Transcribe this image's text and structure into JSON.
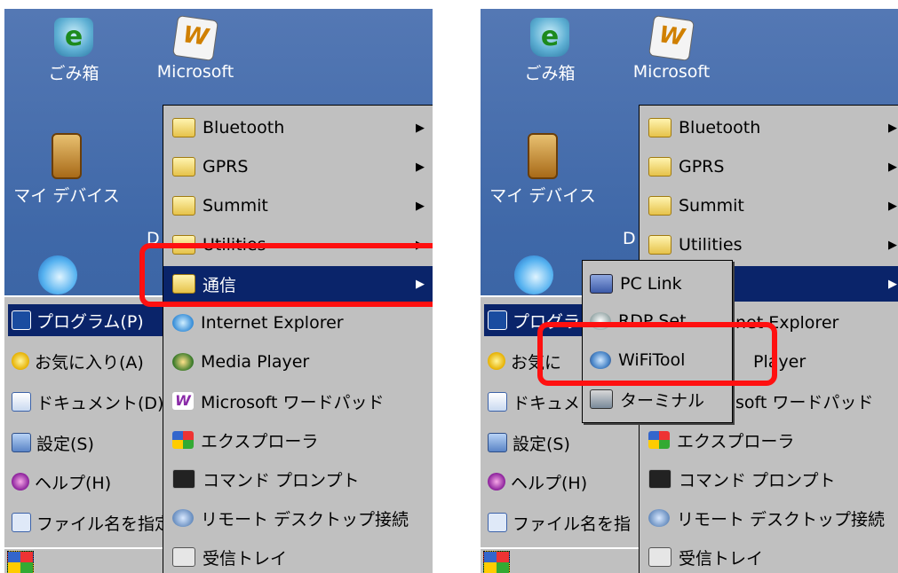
{
  "desktop": {
    "recycle_label": "ごみ箱",
    "wordpad_label": "Microsoft",
    "device_label": "マイ デバイス"
  },
  "start_menu": {
    "programs": "プログラム(P)",
    "favorites": "お気に入り(A)",
    "documents": "ドキュメント(D)",
    "settings": "設定(S)",
    "help": "ヘルプ(H)",
    "run": "ファイル名を指定して実行"
  },
  "programs_menu": {
    "items": [
      {
        "label": "Bluetooth",
        "icon": "folder-icon",
        "submenu": true
      },
      {
        "label": "GPRS",
        "icon": "folder-icon",
        "submenu": true
      },
      {
        "label": "Summit",
        "icon": "folder-icon",
        "submenu": true
      },
      {
        "label": "Utilities",
        "icon": "folder-icon",
        "submenu": true
      },
      {
        "label": "通信",
        "icon": "folder-icon",
        "submenu": true
      },
      {
        "label": "Internet Explorer",
        "icon": "internet-explorer-icon"
      },
      {
        "label": "Media Player",
        "icon": "media-player-icon"
      },
      {
        "label": "Microsoft ワードパッド",
        "icon": "wordpad-icon"
      },
      {
        "label": "エクスプローラ",
        "icon": "explorer-icon"
      },
      {
        "label": "コマンド プロンプト",
        "icon": "command-prompt-icon"
      },
      {
        "label": "リモート デスクトップ接続",
        "icon": "remote-desktop-icon"
      },
      {
        "label": "受信トレイ",
        "icon": "inbox-icon"
      }
    ]
  },
  "communication_submenu": {
    "items": [
      {
        "label": "PC Link",
        "icon": "pc-link-icon"
      },
      {
        "label": "RDP Set",
        "icon": "rdp-set-icon"
      },
      {
        "label": "WiFiTool",
        "icon": "wifi-tool-icon"
      },
      {
        "label": "ターミナル",
        "icon": "terminal-icon"
      }
    ]
  },
  "partial_text": {
    "d_letter": "D",
    "programs_clipped": "プログラ",
    "favorites_clipped": "お気に",
    "documents_clipped": "ドキュメ",
    "run_clipped": "ファイル名を指",
    "explorer_clipped": "net Explorer",
    "player_clipped": "Player",
    "wordpad_clipped": "soft ワードパッド"
  },
  "colors": {
    "highlight_box": "#ff1010",
    "menu_selection": "#0a246a",
    "menu_background": "#c0c0c0",
    "desktop": "#3f6aa6"
  }
}
